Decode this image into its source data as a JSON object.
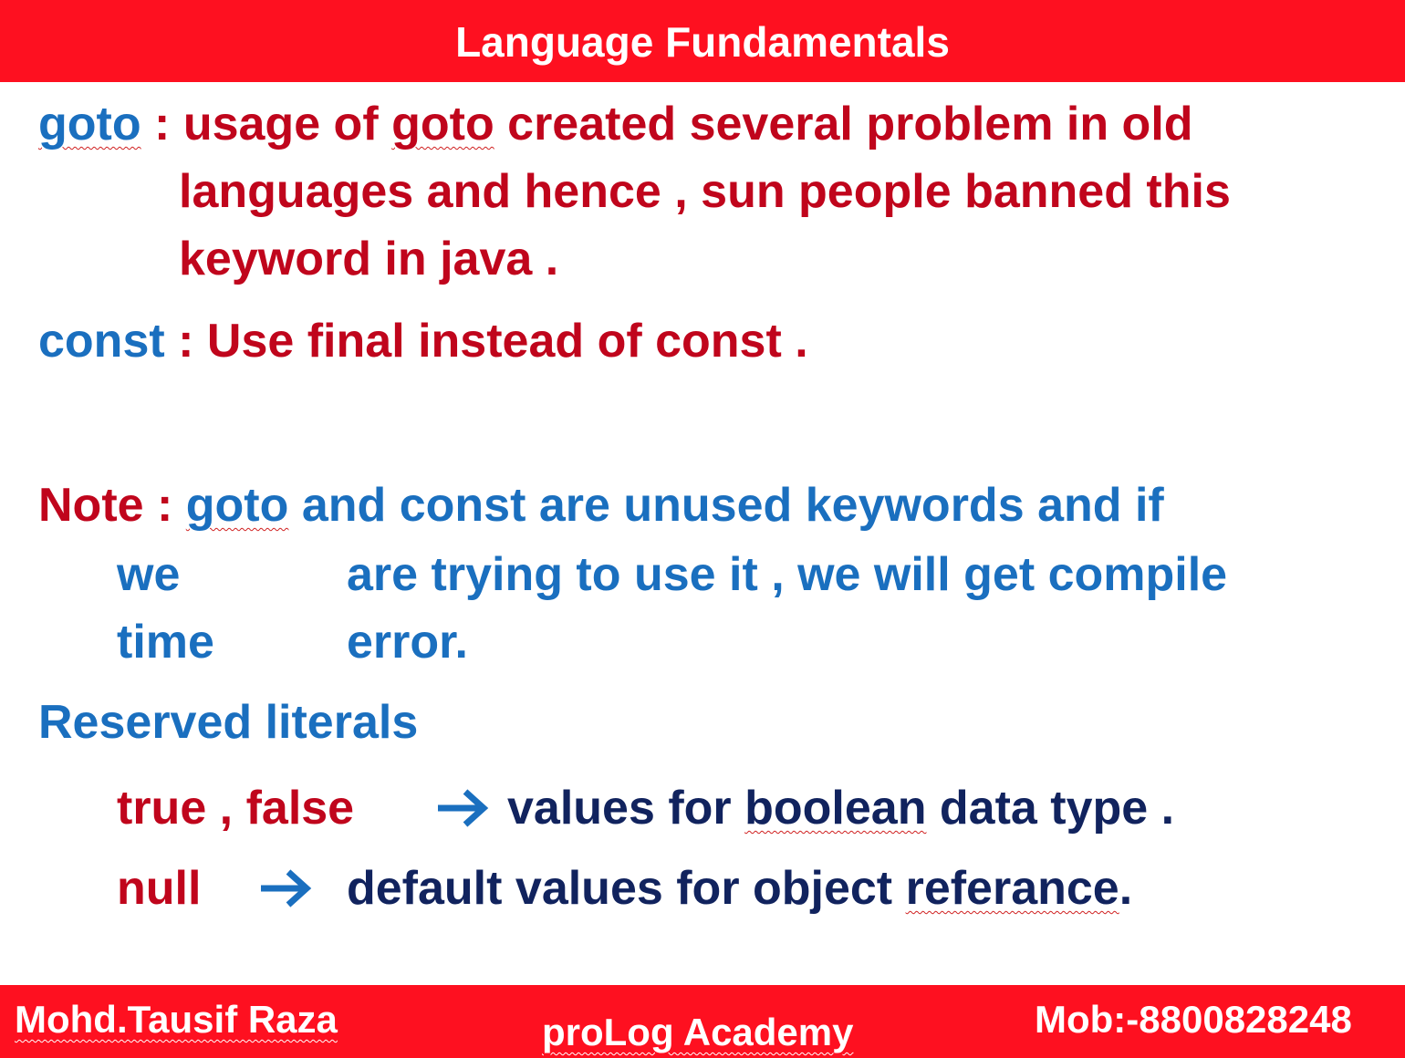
{
  "header": {
    "title": "Language Fundamentals"
  },
  "goto_entry": {
    "keyword": "goto",
    "separator": " :",
    "line1_a": " usage of ",
    "line1_goto": "goto",
    "line1_b": " created several problem in old",
    "line2": "languages and hence , sun people banned this",
    "line3": "keyword in java ."
  },
  "const_entry": {
    "keyword": "const",
    "separator": " :",
    "text": " Use final instead of const ."
  },
  "note": {
    "label": "Note :",
    "goto": "goto",
    "line1_rest": " and const are unused keywords and if",
    "line2_a": "we",
    "line2_b": "are trying to use it , we will get compile",
    "line3_a": "time",
    "line3_b": "error."
  },
  "reserved": {
    "heading": "Reserved literals",
    "row1": {
      "term": "true , false",
      "arrow_icon": "right-arrow",
      "desc_a": "values for ",
      "desc_link": "boolean",
      "desc_b": " data type ."
    },
    "row2": {
      "term": "null",
      "arrow_icon": "right-arrow",
      "desc_a": "default values for object ",
      "desc_link": "referance",
      "desc_b": "."
    }
  },
  "footer": {
    "author": "Mohd.Tausif Raza",
    "academy": "proLog Academy",
    "mobile": "Mob:-8800828248"
  },
  "colors": {
    "banner": "#fe1020",
    "red_text": "#c0051c",
    "blue_text": "#1a6fbf",
    "navy_text": "#11235e"
  }
}
